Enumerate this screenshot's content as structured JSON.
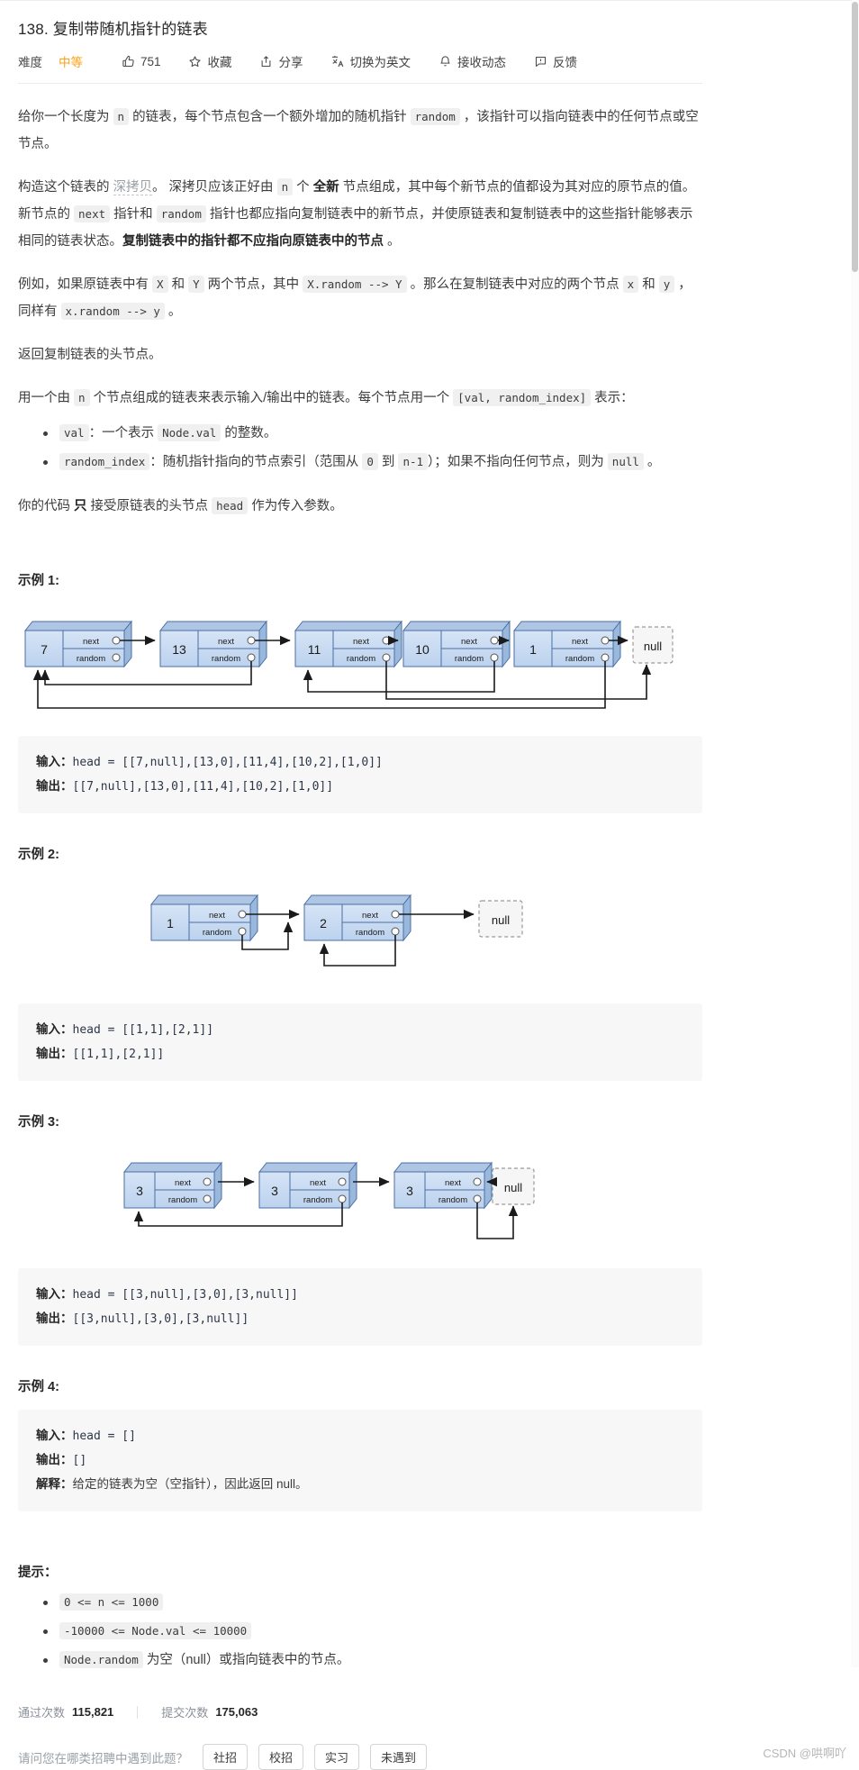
{
  "header": {
    "title": "138. 复制带随机指针的链表",
    "toolbar": {
      "difficulty_label": "难度",
      "difficulty_value": "中等",
      "like_count": "751",
      "favorite_label": "收藏",
      "share_label": "分享",
      "translate_label": "切换为英文",
      "notify_label": "接收动态",
      "feedback_label": "反馈"
    }
  },
  "description": {
    "p1": {
      "t1": "给你一个长度为 ",
      "c1": "n",
      "t2": " 的链表，每个节点包含一个额外增加的随机指针 ",
      "c2": "random",
      "t3": " ，该指针可以指向链表中的任何节点或空节点。"
    },
    "p2": {
      "t1": "构造这个链表的 ",
      "link": "深拷贝",
      "t2": "。 深拷贝应该正好由 ",
      "c1": "n",
      "t3": " 个 ",
      "b1": "全新",
      "t4": " 节点组成，其中每个新节点的值都设为其对应的原节点的值。新节点的 ",
      "c2": "next",
      "t5": " 指针和 ",
      "c3": "random",
      "t6": " 指针也都应指向复制链表中的新节点，并使原链表和复制链表中的这些指针能够表示相同的链表状态。",
      "b2": "复制链表中的指针都不应指向原链表中的节点",
      "t7": " 。"
    },
    "p3": {
      "t1": "例如，如果原链表中有 ",
      "c1": "X",
      "t2": " 和 ",
      "c2": "Y",
      "t3": " 两个节点，其中 ",
      "c3": "X.random --> Y",
      "t4": " 。那么在复制链表中对应的两个节点 ",
      "c4": "x",
      "t5": " 和 ",
      "c5": "y",
      "t6": " ，同样有 ",
      "c6": "x.random --> y",
      "t7": " 。"
    },
    "p4": "返回复制链表的头节点。",
    "p5": {
      "t1": "用一个由 ",
      "c1": "n",
      "t2": " 个节点组成的链表来表示输入/输出中的链表。每个节点用一个 ",
      "c2": "[val, random_index]",
      "t3": " 表示："
    },
    "bullets": [
      {
        "c1": "val",
        "t1": "：一个表示 ",
        "c2": "Node.val",
        "t2": " 的整数。"
      },
      {
        "c1": "random_index",
        "t1": "：随机指针指向的节点索引（范围从 ",
        "c2": "0",
        "t2": " 到 ",
        "c3": "n-1",
        "t3": "）；如果不指向任何节点，则为 ",
        "c4": "null",
        "t4": " 。"
      }
    ],
    "p6": {
      "t1": "你的代码 ",
      "b1": "只",
      "t2": " 接受原链表的头节点 ",
      "c1": "head",
      "t3": " 作为传入参数。"
    }
  },
  "examples": [
    {
      "heading": "示例 1:",
      "input_label": "输入：",
      "input_value": "head = [[7,null],[13,0],[11,4],[10,2],[1,0]]",
      "output_label": "输出：",
      "output_value": "[[7,null],[13,0],[11,4],[10,2],[1,0]]",
      "diagram": {
        "node_label_next": "next",
        "node_label_random": "random",
        "null_label": "null",
        "nodes": [
          {
            "val": "7",
            "random": null
          },
          {
            "val": "13",
            "random": 0
          },
          {
            "val": "11",
            "random": 4
          },
          {
            "val": "10",
            "random": 2
          },
          {
            "val": "1",
            "random": 0
          }
        ]
      }
    },
    {
      "heading": "示例 2:",
      "input_label": "输入：",
      "input_value": "head = [[1,1],[2,1]]",
      "output_label": "输出：",
      "output_value": "[[1,1],[2,1]]",
      "diagram": {
        "node_label_next": "next",
        "node_label_random": "random",
        "null_label": "null",
        "nodes": [
          {
            "val": "1",
            "random": 1
          },
          {
            "val": "2",
            "random": 1
          }
        ]
      }
    },
    {
      "heading": "示例 3:",
      "input_label": "输入：",
      "input_value": "head = [[3,null],[3,0],[3,null]]",
      "output_label": "输出：",
      "output_value": "[[3,null],[3,0],[3,null]]",
      "diagram": {
        "node_label_next": "next",
        "node_label_random": "random",
        "null_label": "null",
        "nodes": [
          {
            "val": "3",
            "random": null
          },
          {
            "val": "3",
            "random": 0
          },
          {
            "val": "3",
            "random": null
          }
        ]
      }
    },
    {
      "heading": "示例 4:",
      "input_label": "输入：",
      "input_value": "head = []",
      "output_label": "输出：",
      "output_value": "[]",
      "explain_label": "解释：",
      "explain_value": "给定的链表为空（空指针），因此返回 null。"
    }
  ],
  "hints": {
    "heading": "提示：",
    "items": [
      {
        "code": "0 <= n <= 1000"
      },
      {
        "code": "-10000 <= Node.val <= 10000"
      },
      {
        "code": "Node.random",
        "text": " 为空（null）或指向链表中的节点。"
      }
    ]
  },
  "stats": {
    "pass_label": "通过次数",
    "pass_value": "115,821",
    "submit_label": "提交次数",
    "submit_value": "175,063"
  },
  "survey": {
    "question": "请问您在哪类招聘中遇到此题？",
    "options": [
      "社招",
      "校招",
      "实习",
      "未遇到"
    ]
  },
  "watermark": "CSDN @哄啊吖",
  "colors": {
    "accent_orange": "#ffa116",
    "node_fill": "#c6d9f1",
    "node_stroke": "#4a6fa5",
    "code_bg": "#f7f7f8"
  }
}
